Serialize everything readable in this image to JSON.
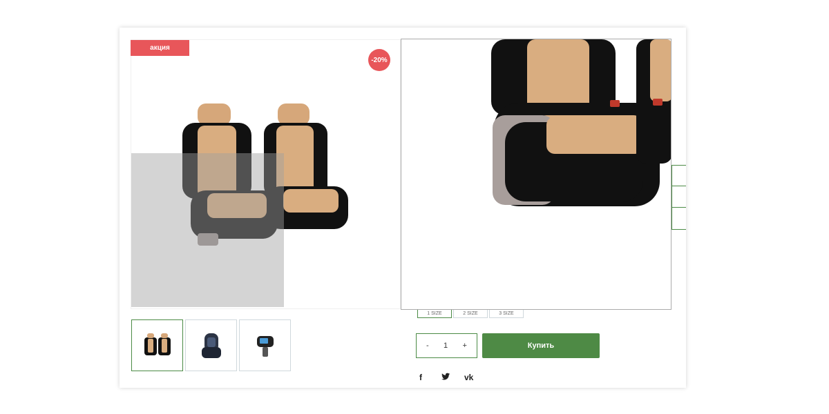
{
  "badges": {
    "promo": "акция",
    "discount": "-20%"
  },
  "product": {
    "main_image": "car-seat-covers-beige-black",
    "thumbnails": [
      {
        "image": "car-seat-covers-beige-black",
        "active": true
      },
      {
        "image": "child-car-seat-dark",
        "active": false
      },
      {
        "image": "fm-transmitter",
        "active": false
      }
    ]
  },
  "sizes": [
    {
      "label": "1 SIZE",
      "active": true
    },
    {
      "label": "2 SIZE",
      "active": false
    },
    {
      "label": "3 SIZE",
      "active": false
    }
  ],
  "quantity": {
    "minus": "-",
    "value": "1",
    "plus": "+"
  },
  "buy_label": "Купить",
  "social": {
    "facebook": "f",
    "twitter": "twitter-icon",
    "vk": "vk"
  },
  "colors": {
    "accent_green": "#4e8a45",
    "badge_red": "#e8565a"
  }
}
